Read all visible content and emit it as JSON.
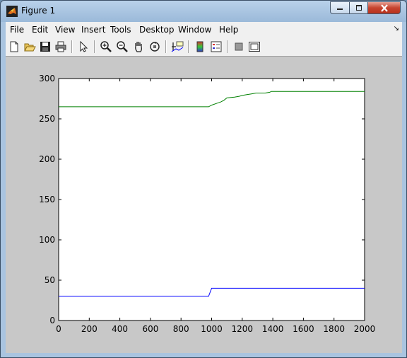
{
  "window": {
    "title": "Figure 1",
    "minimize_icon": "minimize-icon",
    "maximize_icon": "maximize-icon",
    "close_icon": "close-icon"
  },
  "menubar": {
    "items": [
      "File",
      "Edit",
      "View",
      "Insert",
      "Tools",
      "Desktop",
      "Window",
      "Help"
    ],
    "dock_icon": "dock-arrow-icon"
  },
  "toolbar": {
    "buttons": [
      {
        "icon": "new-figure-icon"
      },
      {
        "icon": "open-file-icon"
      },
      {
        "icon": "save-icon"
      },
      {
        "icon": "print-icon"
      },
      {
        "icon": "pointer-icon"
      },
      {
        "icon": "zoom-in-icon"
      },
      {
        "icon": "zoom-out-icon"
      },
      {
        "icon": "pan-hand-icon"
      },
      {
        "icon": "rotate-3d-icon"
      },
      {
        "icon": "data-cursor-icon"
      },
      {
        "icon": "colorbar-icon"
      },
      {
        "icon": "legend-icon"
      },
      {
        "icon": "hide-plot-tools-icon"
      },
      {
        "icon": "show-plot-tools-icon"
      }
    ]
  },
  "colors": {
    "figure_bg": "#c8c8c8",
    "axes_bg": "#ffffff",
    "series_green": "#008000",
    "series_blue": "#0000ff"
  },
  "chart_data": {
    "type": "line",
    "title": "",
    "xlabel": "",
    "ylabel": "",
    "xlim": [
      0,
      2000
    ],
    "ylim": [
      0,
      300
    ],
    "xticks": [
      0,
      200,
      400,
      600,
      800,
      1000,
      1200,
      1400,
      1600,
      1800,
      2000
    ],
    "yticks": [
      0,
      50,
      100,
      150,
      200,
      250,
      300
    ],
    "grid": false,
    "legend": "none",
    "series": [
      {
        "color": "#008000",
        "x": [
          0,
          980,
          1000,
          1030,
          1060,
          1080,
          1100,
          1150,
          1180,
          1200,
          1230,
          1260,
          1290,
          1320,
          1350,
          1380,
          1390,
          1400,
          2000
        ],
        "y": [
          265,
          265,
          267,
          269,
          271,
          273,
          276,
          277,
          278,
          279,
          280,
          281,
          282,
          282,
          282,
          283,
          284,
          284,
          284
        ]
      },
      {
        "color": "#0000ff",
        "x": [
          0,
          980,
          1000,
          2000
        ],
        "y": [
          30,
          30,
          40,
          40
        ]
      }
    ]
  }
}
